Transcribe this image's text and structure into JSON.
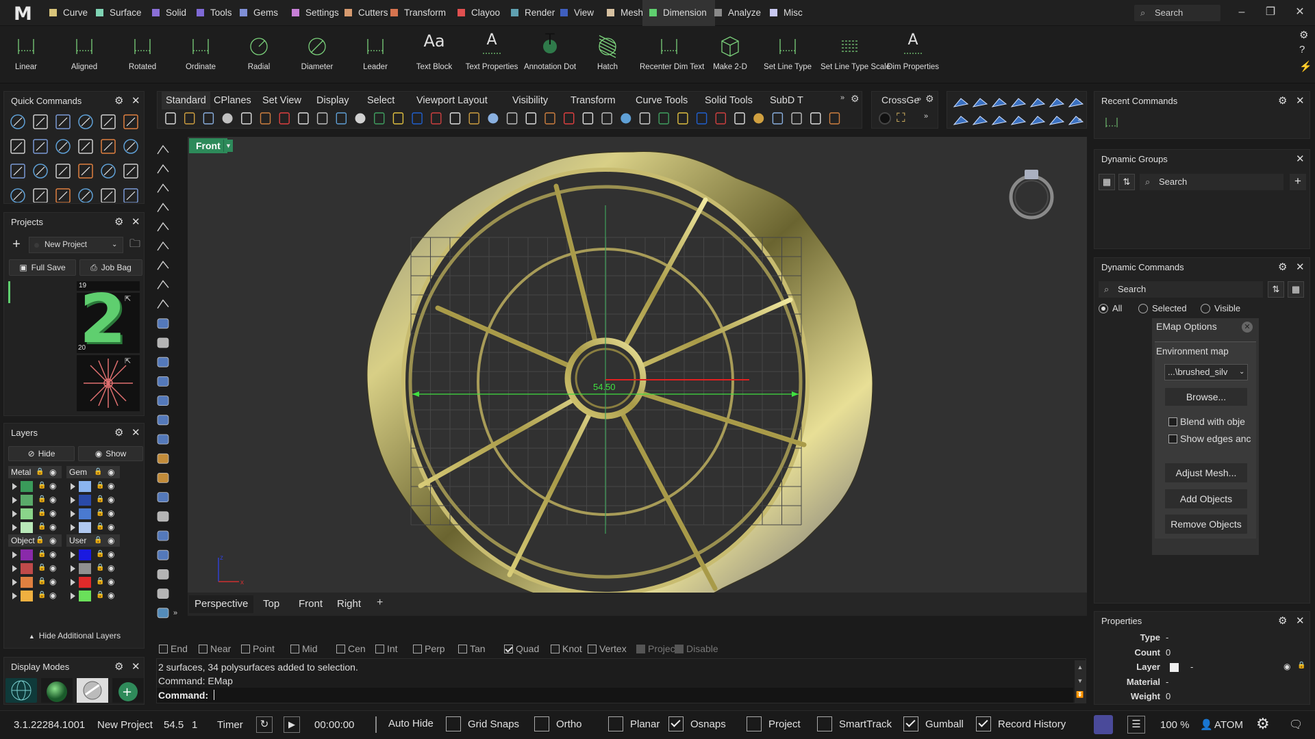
{
  "app": {
    "logo": "M"
  },
  "menu": [
    {
      "label": "Curve",
      "color": "#d8c47a"
    },
    {
      "label": "Surface",
      "color": "#7fd4b4"
    },
    {
      "label": "Solid",
      "color": "#8a6fd6"
    },
    {
      "label": "Tools",
      "color": "#7f6ad6"
    },
    {
      "label": "Gems",
      "color": "#7f8fd6"
    },
    {
      "label": "Settings",
      "color": "#c77fd6"
    },
    {
      "label": "Cutters",
      "color": "#d69a6f"
    },
    {
      "label": "Transform",
      "color": "#d6744f"
    },
    {
      "label": "Clayoo",
      "color": "#e05050"
    },
    {
      "label": "Render",
      "color": "#5fa0b0"
    },
    {
      "label": "View",
      "color": "#3f5fbf"
    },
    {
      "label": "Mesh",
      "color": "#d6c0a0"
    },
    {
      "label": "Dimension",
      "color": "#5fcf6f",
      "active": true
    },
    {
      "label": "Analyze",
      "color": "#8a8a8a"
    },
    {
      "label": "Misc",
      "color": "#c8c8f0"
    }
  ],
  "search_top": {
    "placeholder": "Search"
  },
  "ribbon": [
    {
      "label": "Linear",
      "icon": "linear-dimension-icon"
    },
    {
      "label": "Aligned",
      "icon": "aligned-dimension-icon"
    },
    {
      "label": "Rotated",
      "icon": "rotated-dimension-icon"
    },
    {
      "label": "Ordinate",
      "icon": "ordinate-dimension-icon"
    },
    {
      "label": "Radial",
      "icon": "radial-dimension-icon"
    },
    {
      "label": "Diameter",
      "icon": "diameter-dimension-icon"
    },
    {
      "label": "Leader",
      "icon": "leader-icon"
    },
    {
      "label": "Text Block",
      "icon": "text-block-icon",
      "glyph": "Aa"
    },
    {
      "label": "Text Properties",
      "icon": "text-properties-icon",
      "glyph": "A"
    },
    {
      "label": "Annotation Dot",
      "icon": "annotation-dot-icon",
      "glyph": "T"
    },
    {
      "label": "Hatch",
      "icon": "hatch-icon"
    },
    {
      "label": "Recenter Dim Text",
      "icon": "recenter-dim-text-icon"
    },
    {
      "label": "Make 2-D",
      "icon": "make-2d-icon"
    },
    {
      "label": "Set Line Type",
      "icon": "line-type-icon"
    },
    {
      "label": "Set Line Type Scale",
      "icon": "line-type-scale-icon"
    },
    {
      "label": "Dim Properties",
      "icon": "dim-properties-icon",
      "glyph": "A"
    }
  ],
  "quick_commands": {
    "title": "Quick Commands"
  },
  "projects": {
    "title": "Projects",
    "project_select": "New Project",
    "full_save": "Full Save",
    "job_bag": "Job Bag",
    "thumbs": [
      {
        "num": "19",
        "glyph": "2"
      },
      {
        "num": "20"
      }
    ]
  },
  "layers": {
    "title": "Layers",
    "hide": "Hide",
    "show": "Show",
    "groups": [
      {
        "name": "Metal",
        "colors": [
          "#3a9a5a",
          "#5aaa6a",
          "#8ad48a",
          "#b8e8b8"
        ]
      },
      {
        "name": "Gem",
        "colors": [
          "#8ab4f0",
          "#2a4aa8",
          "#4a7ad0",
          "#b0c8f0"
        ]
      },
      {
        "name": "Object",
        "colors": [
          "#8a2aaa",
          "#c04a4a",
          "#e08040",
          "#f0b040"
        ]
      },
      {
        "name": "User",
        "colors": [
          "#1a1ae0",
          "#909090",
          "#e02a2a",
          "#6ae05a"
        ]
      }
    ],
    "hide_additional": "Hide Additional Layers"
  },
  "display_modes": {
    "title": "Display Modes"
  },
  "viewport_tabs_top": [
    "Standard",
    "CPlanes",
    "Set View",
    "Display",
    "Select",
    "Viewport Layout",
    "Visibility",
    "Transform",
    "Curve Tools",
    "Solid Tools",
    "SubD T"
  ],
  "crossge_tab": "CrossGe",
  "viewport": {
    "name": "Front",
    "dimension": "54.50",
    "axis_z": "z",
    "axis_x": "x",
    "tabs": [
      "Perspective",
      "Top",
      "Front",
      "Right"
    ]
  },
  "osnaps": [
    {
      "label": "End",
      "checked": false
    },
    {
      "label": "Near",
      "checked": false
    },
    {
      "label": "Point",
      "checked": false
    },
    {
      "label": "Mid",
      "checked": false
    },
    {
      "label": "Cen",
      "checked": false
    },
    {
      "label": "Int",
      "checked": false
    },
    {
      "label": "Perp",
      "checked": false
    },
    {
      "label": "Tan",
      "checked": false
    },
    {
      "label": "Quad",
      "checked": true
    },
    {
      "label": "Knot",
      "checked": false
    },
    {
      "label": "Vertex",
      "checked": false
    },
    {
      "label": "Project",
      "checked": false,
      "disabled": true
    },
    {
      "label": "Disable",
      "checked": false,
      "disabled": true
    }
  ],
  "command": {
    "history": [
      "2 surfaces, 34 polysurfaces added to selection.",
      "Command: EMap"
    ],
    "prompt": "Command:"
  },
  "recent_commands": {
    "title": "Recent Commands"
  },
  "dynamic_groups": {
    "title": "Dynamic Groups",
    "search": "Search"
  },
  "dynamic_commands": {
    "title": "Dynamic Commands",
    "search": "Search",
    "filters": [
      {
        "label": "All",
        "on": true
      },
      {
        "label": "Selected",
        "on": false
      },
      {
        "label": "Visible",
        "on": false
      }
    ],
    "emap": {
      "title": "EMap Options",
      "env_label": "Environment map",
      "env_value": "...\\brushed_silv",
      "browse": "Browse...",
      "blend": "Blend with obje",
      "show_edges": "Show edges anc",
      "adjust_mesh": "Adjust Mesh...",
      "add_objects": "Add Objects",
      "remove_objects": "Remove Objects"
    }
  },
  "properties": {
    "title": "Properties",
    "rows": [
      {
        "key": "Type",
        "value": "-"
      },
      {
        "key": "Count",
        "value": "0"
      },
      {
        "key": "Layer",
        "value": "-"
      },
      {
        "key": "Material",
        "value": "-"
      },
      {
        "key": "Weight",
        "value": "0"
      }
    ]
  },
  "statusbar": {
    "version": "3.1.22284.1001",
    "project": "New Project",
    "value1": "54.5",
    "value2": "1",
    "timer": "Timer",
    "time": "00:00:00",
    "auto_hide": "Auto Hide",
    "toggles": [
      {
        "label": "Grid Snaps",
        "checked": false
      },
      {
        "label": "Ortho",
        "checked": false
      },
      {
        "label": "Planar",
        "checked": false
      },
      {
        "label": "Osnaps",
        "checked": true
      },
      {
        "label": "Project",
        "checked": false
      },
      {
        "label": "SmartTrack",
        "checked": false
      },
      {
        "label": "Gumball",
        "checked": true
      },
      {
        "label": "Record History",
        "checked": true
      }
    ],
    "zoom": "100 %",
    "user": "ATOM"
  }
}
